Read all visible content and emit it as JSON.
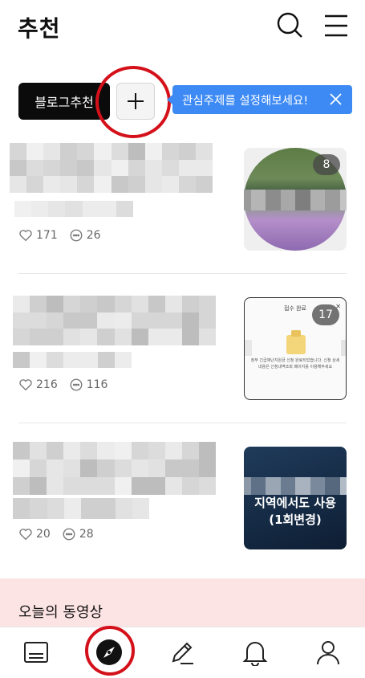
{
  "header": {
    "title": "추천",
    "icons": [
      "search-icon",
      "menu-icon"
    ]
  },
  "chips": {
    "blog_recommend_label": "블로그추천",
    "add_label": "+",
    "tooltip_text": "관심주제를 설정해보세요!"
  },
  "feed": [
    {
      "likes": "171",
      "comments": "26",
      "thumb_badge": ""
    },
    {
      "likes": "216",
      "comments": "116",
      "thumb_badge": "17",
      "thumb_doc_title": "접수 완료",
      "thumb_doc_text": "정부 긴급재난지원금 신청 완료되었습니다. 신청 상세내용은 신청내역조회 페이지를 이용해주세요"
    },
    {
      "likes": "20",
      "comments": "28",
      "thumb_badge": "",
      "thumb_caption_line1": "지역에서도 사용",
      "thumb_caption_line2": "(1회변경)"
    }
  ],
  "feed_first_badge": "8",
  "video_section": {
    "title": "오늘의 동영상"
  },
  "bottom_nav": {
    "items": [
      "feed-icon",
      "compass-icon",
      "pencil-icon",
      "bell-icon",
      "person-icon"
    ]
  },
  "colors": {
    "tooltip_bg": "#3d8af5",
    "highlight_circle": "#d4111a",
    "video_section_bg": "#fde4e4"
  }
}
